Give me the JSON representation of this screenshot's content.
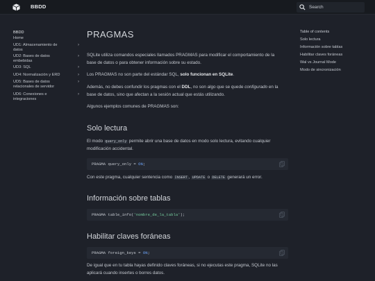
{
  "header": {
    "site_title": "BBDD",
    "search_placeholder": "Search"
  },
  "sidebar": {
    "heading": "BBDD",
    "items": [
      {
        "label": "Home",
        "chevron": false
      },
      {
        "label": "UD1: Almacenamiento de datos",
        "chevron": true
      },
      {
        "label": "UD2: Bases de datos embebidas",
        "chevron": true
      },
      {
        "label": "UD3: SQL",
        "chevron": true
      },
      {
        "label": "UD4: Normalización y ERD",
        "chevron": true
      },
      {
        "label": "UD5: Bases de datos relacionales de servidor",
        "chevron": true
      },
      {
        "label": "UD6: Conexiones e integraciones",
        "chevron": true
      }
    ]
  },
  "toc": {
    "title": "Table of contents",
    "items": [
      "Solo lectura",
      "Información sobre tablas",
      "Habilitar claves foráneas",
      "Wal vs Journal Mode",
      "Modo de sincronización"
    ]
  },
  "content": {
    "title": "PRAGMAS",
    "p1": "SQLite utiliza comandos especiales llamados PRAGMAS para modificar el comportamiento de la base de datos o para obtener información sobre su estado.",
    "p2_a": "Los PRAGMAS no son parte del estándar SQL, ",
    "p2_b": "solo funcionan en SQLite",
    "p2_c": ".",
    "p3_a": "Además, no debes confundir los pragmas con el ",
    "p3_b": "DDL",
    "p3_c": ", no son algo que se quede ",
    "p3_d": "configurado",
    "p3_e": " en la base de datos, sino que afectan a la sesión actual que estás utilizando.",
    "p4": "Algunos ejemplos comunes de PRAGMAS son:",
    "h_solo": "Solo lectura",
    "p5_a": "El modo ",
    "p5_code": "query_only",
    "p5_b": " permite abrir una base de datos en modo solo lectura, evitando cualquier modificación accidental.",
    "code1_a": "PRAGMA query_only = ",
    "code1_b": "ON",
    "code1_c": ";",
    "p6_a": "Con este pragma, cualquier sentencia como ",
    "p6_c1": "INSERT",
    "p6_s1": ", ",
    "p6_c2": "UPDATE",
    "p6_s2": " o ",
    "p6_c3": "DELETE",
    "p6_b": " generará un error.",
    "h_info": "Información sobre tablas",
    "code2_a": "PRAGMA table_info(",
    "code2_b": "'nombre_de_la_tabla'",
    "code2_c": ");",
    "h_fk": "Habilitar claves foráneas",
    "code3_a": "PRAGMA foreign_keys = ",
    "code3_b": "ON",
    "code3_c": ";",
    "p7": "De igual que en tu tabla hayas definido claves foráneas, si no ejecutas este pragma, SQLite no las aplicará cuando insertes o borres datos."
  }
}
